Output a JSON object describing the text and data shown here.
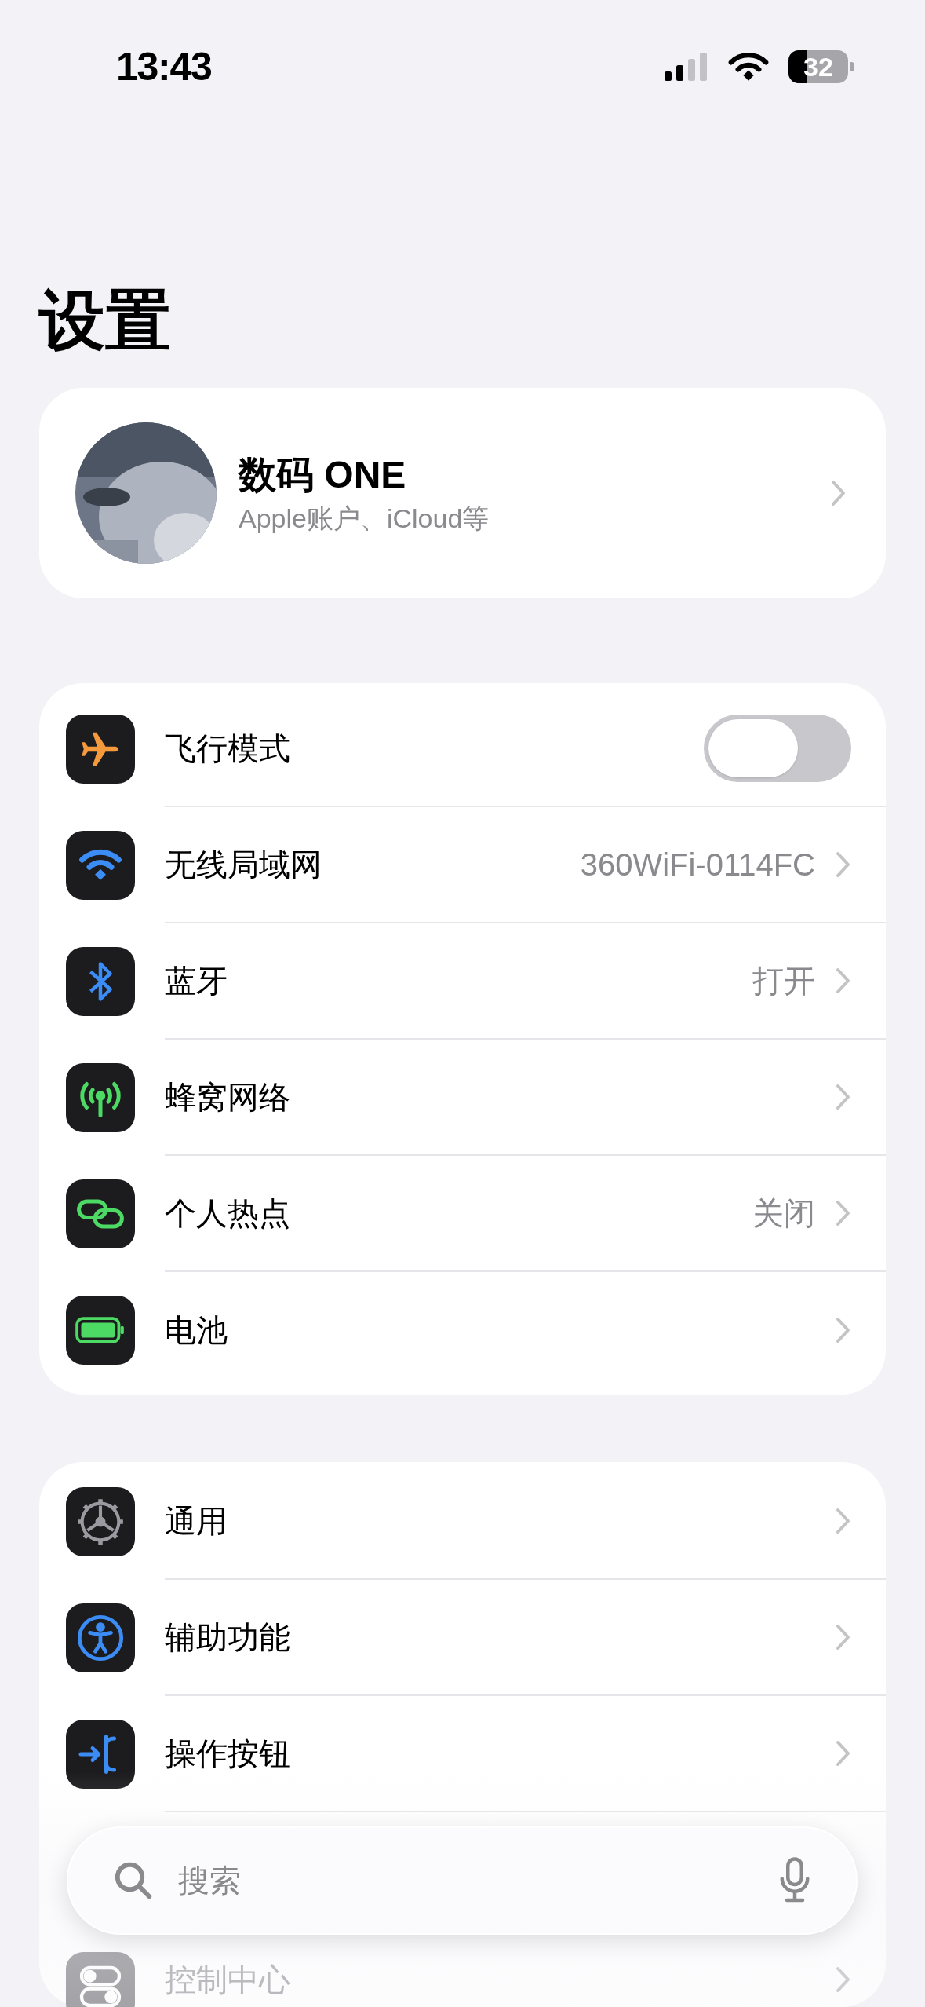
{
  "status_bar": {
    "time": "13:43",
    "battery": "32"
  },
  "title": "设置",
  "profile": {
    "name": "数码 ONE",
    "subtitle": "Apple账户、iCloud等"
  },
  "groups": [
    {
      "rows": [
        {
          "kind": "toggle",
          "label": "飞行模式",
          "on": false
        },
        {
          "kind": "link",
          "label": "无线局域网",
          "value": "360WiFi-0114FC"
        },
        {
          "kind": "link",
          "label": "蓝牙",
          "value": "打开"
        },
        {
          "kind": "link",
          "label": "蜂窝网络"
        },
        {
          "kind": "link",
          "label": "个人热点",
          "value": "关闭"
        },
        {
          "kind": "link",
          "label": "电池"
        }
      ]
    },
    {
      "rows": [
        {
          "kind": "link",
          "label": "通用"
        },
        {
          "kind": "link",
          "label": "辅助功能"
        },
        {
          "kind": "link",
          "label": "操作按钮"
        },
        {
          "kind": "hidden"
        },
        {
          "kind": "link",
          "label": "控制中心"
        }
      ]
    }
  ],
  "search": {
    "placeholder": "搜索"
  }
}
